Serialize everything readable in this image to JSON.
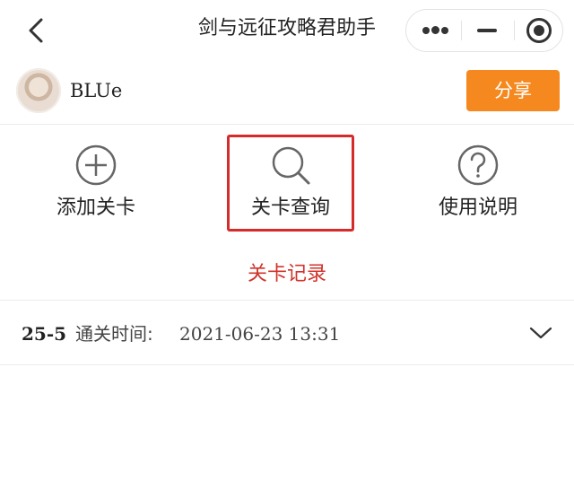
{
  "titlebar": {
    "title": "剑与远征攻略君助手",
    "back_icon": "chevron-left-icon",
    "capsule_icons": [
      "more-dots-icon",
      "minimize-icon",
      "close-target-icon"
    ]
  },
  "user": {
    "name": "BLUe",
    "avatar_icon": "user-avatar"
  },
  "share": {
    "label": "分享",
    "color": "#f5891f"
  },
  "actions": [
    {
      "label": "添加关卡",
      "icon": "plus-circle-icon"
    },
    {
      "label": "关卡查询",
      "icon": "search-icon",
      "highlighted": true
    },
    {
      "label": "使用说明",
      "icon": "help-circle-icon"
    }
  ],
  "highlight_color": "#d62b2b",
  "records": {
    "title": "关卡记录",
    "title_color": "#d0342c",
    "items": [
      {
        "level": "25-5",
        "label": "通关时间:",
        "time": "2021-06-23 13:31",
        "icon": "chevron-down-icon"
      }
    ]
  }
}
